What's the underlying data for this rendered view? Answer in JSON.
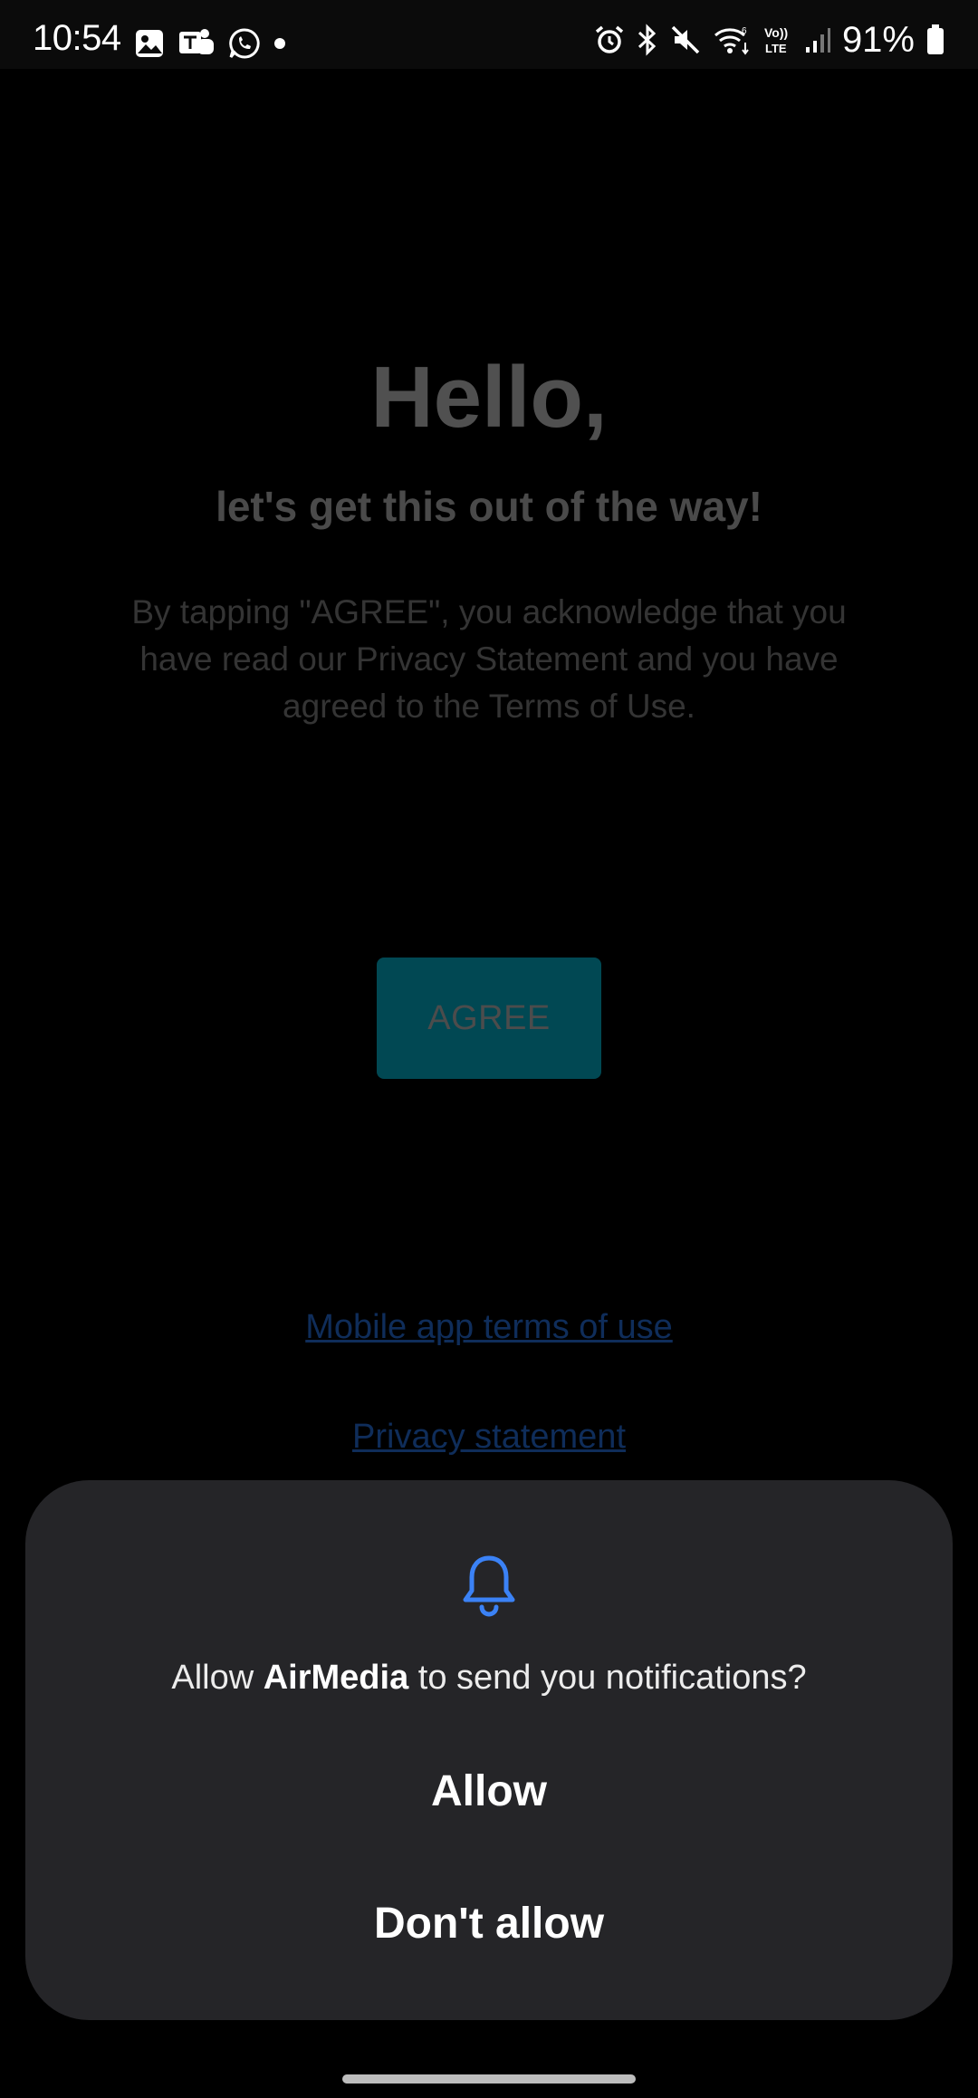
{
  "status_bar": {
    "time": "10:54",
    "battery_percent": "91%",
    "network_label": "Vo)) LTE"
  },
  "onboarding": {
    "greeting": "Hello,",
    "subtitle": "let's get this out of the way!",
    "consent_text": "By tapping \"AGREE\", you acknowledge that you have read our Privacy Statement and you have agreed to the Terms of Use.",
    "agree_label": "AGREE",
    "terms_link": "Mobile app terms of use",
    "privacy_link": "Privacy statement"
  },
  "permission_dialog": {
    "message_prefix": "Allow ",
    "app_name": "AirMedia",
    "message_suffix": " to send you notifications?",
    "allow_label": "Allow",
    "deny_label": "Don't allow"
  },
  "colors": {
    "agree_button_bg": "#014853",
    "dialog_bg": "#252528",
    "bell_icon": "#3b82f6",
    "link": "#0f2d5a"
  }
}
